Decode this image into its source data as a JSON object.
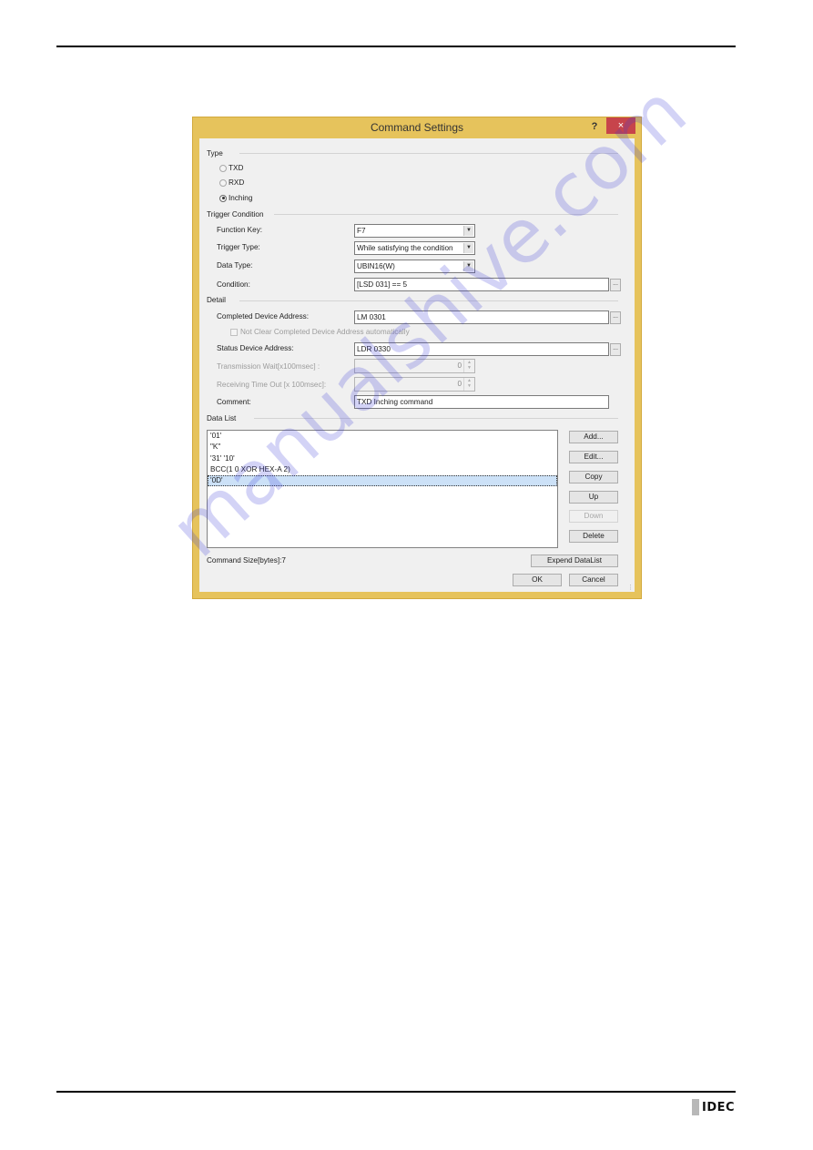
{
  "page": {
    "logo_text": "IDEC",
    "watermark": "manualshive.com"
  },
  "dialog": {
    "title": "Command Settings",
    "help_label": "?",
    "close_label": "×",
    "type": {
      "group_label": "Type",
      "options": [
        {
          "label": "TXD",
          "selected": false
        },
        {
          "label": "RXD",
          "selected": false
        },
        {
          "label": "Inching",
          "selected": true
        }
      ]
    },
    "trigger": {
      "group_label": "Trigger Condition",
      "function_key": {
        "label": "Function Key:",
        "value": "F7"
      },
      "trigger_type": {
        "label": "Trigger Type:",
        "value": "While satisfying the condition"
      },
      "data_type": {
        "label": "Data Type:",
        "value": "UBIN16(W)"
      },
      "condition": {
        "label": "Condition:",
        "value": "[LSD 031] == 5"
      }
    },
    "detail": {
      "group_label": "Detail",
      "completed_address": {
        "label": "Completed Device Address:",
        "value": "LM 0301"
      },
      "not_clear_checkbox": {
        "label": "Not Clear Completed Device Address automatically",
        "checked": false
      },
      "status_address": {
        "label": "Status Device Address:",
        "value": "LDR 0330"
      },
      "transmission_wait": {
        "label": "Transmission Wait[x100msec] :",
        "value": "0"
      },
      "receiving_timeout": {
        "label": "Receiving Time Out [x 100msec]:",
        "value": "0"
      },
      "comment": {
        "label": "Comment:",
        "value": "TXD Inching command"
      }
    },
    "data_list": {
      "group_label": "Data List",
      "items": [
        "'01'",
        "\"K\"",
        "'31' '10'",
        "BCC(1 0 XOR HEX-A 2)",
        "'0D'"
      ],
      "selected_index": 4,
      "buttons": {
        "add": "Add...",
        "edit": "Edit...",
        "copy": "Copy",
        "up": "Up",
        "down": "Down",
        "delete": "Delete"
      }
    },
    "command_size": "Command Size[bytes]:7",
    "expand_label": "Expend DataList",
    "ok_label": "OK",
    "cancel_label": "Cancel",
    "ellipsis": "..."
  }
}
